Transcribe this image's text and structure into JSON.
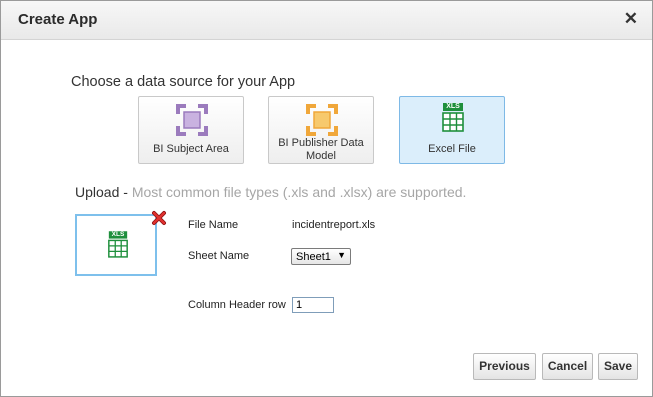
{
  "dialog": {
    "title": "Create App",
    "close_icon": "close-icon"
  },
  "source": {
    "prompt": "Choose a data source for your App",
    "options": [
      {
        "label": "BI Subject Area",
        "icon": "subject-area-icon",
        "color": "#9b7bbd",
        "selected": false
      },
      {
        "label": "BI Publisher Data Model",
        "icon": "data-model-icon",
        "color": "#f0a73a",
        "selected": false
      },
      {
        "label": "Excel File",
        "icon": "excel-icon",
        "color": "#1e8f3c",
        "selected": true,
        "badge": "XLS"
      }
    ]
  },
  "upload": {
    "label": "Upload",
    "separator": " - ",
    "note": "Most common file types (.xls and .xlsx) are supported.",
    "preview_badge": "XLS",
    "remove_icon": "remove-icon"
  },
  "form": {
    "file_name_label": "File Name",
    "file_name_value": "incidentreport.xls",
    "sheet_name_label": "Sheet Name",
    "sheet_name_value": "Sheet1",
    "column_header_label": "Column Header row",
    "column_header_value": "1"
  },
  "buttons": {
    "previous": "Previous",
    "cancel": "Cancel",
    "save": "Save"
  },
  "colors": {
    "accent": "#7ec0ec",
    "selected_bg": "#dbeefb",
    "excel_green": "#1e8f3c",
    "note_gray": "#a6a6a6"
  }
}
